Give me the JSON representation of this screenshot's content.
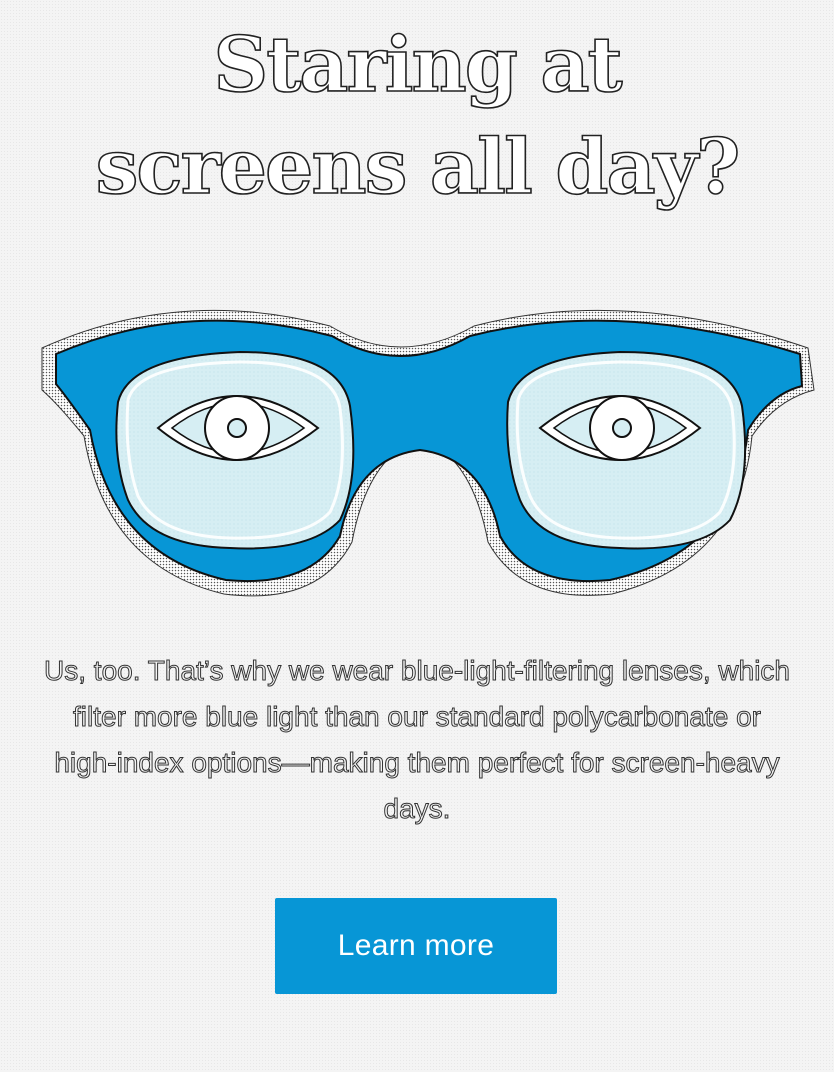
{
  "hero": {
    "title_line1": "Staring at",
    "title_line2": "screens all day?"
  },
  "illustration": {
    "icon": "blue-glasses-with-eyes-icon",
    "frame_color": "#0796d6",
    "lens_color": "#d6eef3"
  },
  "body": {
    "text": "Us, too. That’s why we wear blue-light-filtering lenses, which filter more blue light than our standard polycarbonate or high-index options—making them perfect for screen-heavy days."
  },
  "cta": {
    "label": "Learn more",
    "color": "#0796d6"
  }
}
